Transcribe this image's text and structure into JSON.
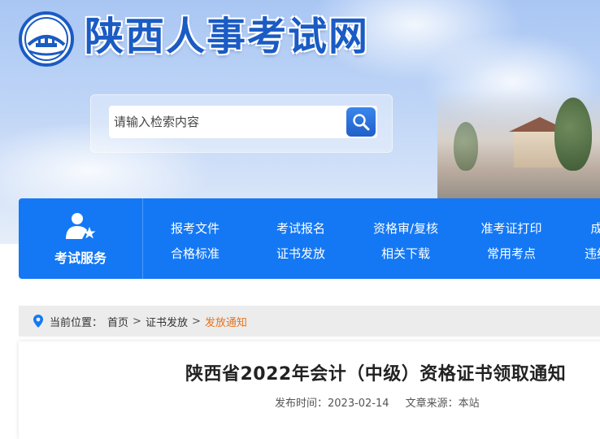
{
  "site": {
    "title": "陕西人事考试网"
  },
  "search": {
    "placeholder": "请输入检索内容"
  },
  "nav": {
    "service_label": "考试服务",
    "row1": [
      "报考文件",
      "考试报名",
      "资格审/复核",
      "准考证打印",
      "成"
    ],
    "row2": [
      "合格标准",
      "证书发放",
      "相关下载",
      "常用考点",
      "违纪"
    ]
  },
  "breadcrumb": {
    "prefix": "当前位置：",
    "items": [
      "首页",
      "证书发放"
    ],
    "current": "发放通知",
    "separator": ">"
  },
  "article": {
    "title": "陕西省2022年会计（中级）资格证书领取通知",
    "publish_label": "发布时间：",
    "publish_date": "2023-02-14",
    "source_label": "文章来源：",
    "source": "本站"
  },
  "colors": {
    "brand_blue": "#1478f5",
    "title_blue": "#1a5bc4",
    "breadcrumb_current": "#e8721a"
  }
}
